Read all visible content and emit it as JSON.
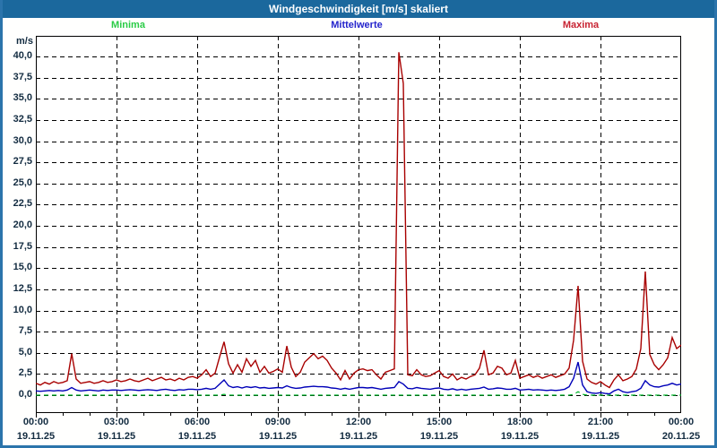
{
  "window": {
    "title": "Windgeschwindigkeit [m/s] skaliert"
  },
  "colors": {
    "titlebar_bg": "#1b689d",
    "titlebar_text": "#ffffff",
    "frame_border": "#2b74ab",
    "axis_text": "#122b40",
    "grid": "#000000",
    "minima_line": "#00b42a",
    "mittelwerte_line": "#0000b8",
    "maxima_line": "#a80000"
  },
  "legend": [
    {
      "label": "Minima",
      "color": "#2acc46"
    },
    {
      "label": "Mittelwerte",
      "color": "#2424cc"
    },
    {
      "label": "Maxima",
      "color": "#c82332"
    }
  ],
  "chart_data": {
    "type": "line",
    "title": "Windgeschwindigkeit [m/s] skaliert",
    "xlabel": "",
    "ylabel": "m/s",
    "ylim": [
      -2.1,
      42.4
    ],
    "yticks": [
      0,
      2.5,
      5,
      7.5,
      10,
      12.5,
      15,
      17.5,
      20,
      22.5,
      25,
      27.5,
      30,
      32.5,
      35,
      37.5,
      40
    ],
    "ytick_labels": [
      "0,0",
      "2,5",
      "5,0",
      "7,5",
      "10,0",
      "12,5",
      "15,0",
      "17,5",
      "20,0",
      "22,5",
      "25,0",
      "27,5",
      "30,0",
      "32,5",
      "35,0",
      "37,5",
      "40,0"
    ],
    "grid": "dashed",
    "legend_position": "top",
    "x_step_minutes": 10,
    "xlim_minutes": [
      0,
      1440
    ],
    "minor_tick_interval_minutes": 60,
    "xticks": [
      {
        "minute": 0,
        "time": "00:00",
        "date": "19.11.25"
      },
      {
        "minute": 180,
        "time": "03:00",
        "date": "19.11.25"
      },
      {
        "minute": 360,
        "time": "06:00",
        "date": "19.11.25"
      },
      {
        "minute": 540,
        "time": "09:00",
        "date": "19.11.25"
      },
      {
        "minute": 720,
        "time": "12:00",
        "date": "19.11.25"
      },
      {
        "minute": 900,
        "time": "15:00",
        "date": "19.11.25"
      },
      {
        "minute": 1080,
        "time": "18:00",
        "date": "19.11.25"
      },
      {
        "minute": 1260,
        "time": "21:00",
        "date": "19.11.25"
      },
      {
        "minute": 1440,
        "time": "00:00",
        "date": "20.11.25"
      }
    ],
    "series": [
      {
        "name": "Minima",
        "color": "#00b42a",
        "style": "dashed",
        "values": [
          0,
          0,
          0,
          0,
          0,
          0,
          0,
          0,
          0,
          0,
          0,
          0,
          0,
          0,
          0,
          0,
          0,
          0,
          0,
          0,
          0,
          0,
          0,
          0,
          0,
          0,
          0,
          0,
          0,
          0,
          0,
          0,
          0,
          0,
          0,
          0,
          0,
          0,
          0,
          0,
          0,
          0,
          0.1,
          0,
          0,
          0,
          0,
          0,
          0,
          0,
          0,
          0,
          0,
          0,
          0,
          0,
          0,
          0,
          0,
          0,
          0,
          0,
          0,
          0,
          0,
          0,
          0,
          0,
          0,
          0,
          0,
          0,
          0,
          0,
          0,
          0,
          0,
          0,
          0,
          0,
          0,
          0,
          0,
          0,
          0,
          0,
          0,
          0,
          0,
          0,
          0,
          0,
          0,
          0,
          0,
          0,
          0,
          0,
          0,
          0,
          0,
          0,
          0,
          0,
          0,
          0,
          0,
          0,
          0,
          0,
          0,
          0,
          0,
          0,
          0,
          0,
          0,
          0,
          0,
          0,
          0.1,
          0.4,
          0.1,
          0,
          0,
          0,
          0,
          0,
          0,
          0,
          0,
          0,
          0,
          0,
          0,
          0,
          0,
          0,
          0,
          0,
          0,
          0,
          0,
          0,
          0
        ]
      },
      {
        "name": "Mittelwerte",
        "color": "#0000b8",
        "style": "solid",
        "values": [
          0.5,
          0.45,
          0.5,
          0.55,
          0.5,
          0.55,
          0.5,
          0.6,
          0.9,
          0.6,
          0.5,
          0.55,
          0.6,
          0.55,
          0.5,
          0.6,
          0.55,
          0.6,
          0.6,
          0.55,
          0.6,
          0.65,
          0.6,
          0.55,
          0.6,
          0.65,
          0.6,
          0.55,
          0.65,
          0.7,
          0.6,
          0.55,
          0.65,
          0.6,
          0.7,
          0.7,
          0.65,
          0.7,
          0.8,
          0.7,
          0.8,
          1.3,
          1.8,
          1.1,
          0.9,
          1.0,
          0.85,
          1.0,
          0.9,
          1.0,
          0.85,
          0.9,
          0.8,
          0.85,
          0.9,
          0.85,
          1.1,
          0.9,
          0.8,
          0.85,
          0.95,
          1.0,
          1.05,
          1.0,
          1.0,
          0.95,
          0.85,
          0.8,
          0.7,
          0.8,
          0.7,
          0.8,
          0.9,
          0.9,
          0.85,
          0.9,
          0.8,
          0.7,
          0.8,
          0.85,
          0.9,
          1.6,
          1.3,
          0.8,
          0.75,
          0.9,
          0.8,
          0.75,
          0.7,
          0.8,
          0.85,
          0.7,
          0.65,
          0.75,
          0.6,
          0.7,
          0.6,
          0.7,
          0.75,
          0.8,
          0.95,
          0.7,
          0.75,
          0.85,
          0.8,
          0.7,
          0.7,
          0.8,
          0.6,
          0.65,
          0.7,
          0.6,
          0.65,
          0.6,
          0.55,
          0.6,
          0.55,
          0.6,
          0.7,
          1.0,
          2.0,
          3.9,
          1.2,
          0.4,
          0.25,
          0.2,
          0.3,
          0.2,
          0.15,
          0.5,
          0.7,
          0.4,
          0.3,
          0.4,
          0.5,
          0.8,
          1.7,
          1.2,
          1.0,
          0.95,
          1.1,
          1.2,
          1.4,
          1.2,
          1.3
        ]
      },
      {
        "name": "Maxima",
        "color": "#a80000",
        "style": "solid",
        "values": [
          1.4,
          1.2,
          1.5,
          1.3,
          1.6,
          1.4,
          1.5,
          1.7,
          4.9,
          1.9,
          1.4,
          1.5,
          1.6,
          1.4,
          1.5,
          1.7,
          1.5,
          1.6,
          1.8,
          1.6,
          1.7,
          1.9,
          1.7,
          1.6,
          1.8,
          2.0,
          1.7,
          1.9,
          2.1,
          1.8,
          1.9,
          1.7,
          2.0,
          1.8,
          2.1,
          2.2,
          2.0,
          2.4,
          3.0,
          2.2,
          2.6,
          4.5,
          6.3,
          3.7,
          2.6,
          3.6,
          2.7,
          4.3,
          3.4,
          4.1,
          2.7,
          3.4,
          2.6,
          2.8,
          3.1,
          2.7,
          5.8,
          3.3,
          2.2,
          2.7,
          3.9,
          4.4,
          4.9,
          4.3,
          4.6,
          4.1,
          3.2,
          2.6,
          1.8,
          2.9,
          1.9,
          2.6,
          3.0,
          3.1,
          2.9,
          3.0,
          2.4,
          1.9,
          2.7,
          2.9,
          3.1,
          40.5,
          36.8,
          2.4,
          2.3,
          3.0,
          2.4,
          2.2,
          2.3,
          2.6,
          2.9,
          2.2,
          2.0,
          2.5,
          1.8,
          2.1,
          1.9,
          2.2,
          2.4,
          3.2,
          5.3,
          2.4,
          2.6,
          3.4,
          3.2,
          2.4,
          2.6,
          4.1,
          2.0,
          2.2,
          2.4,
          2.1,
          2.3,
          2.0,
          2.2,
          2.4,
          2.1,
          2.3,
          2.5,
          3.2,
          6.5,
          12.9,
          4.0,
          1.9,
          1.5,
          1.3,
          1.6,
          1.2,
          0.9,
          1.8,
          2.4,
          1.7,
          1.9,
          2.2,
          3.1,
          5.5,
          14.6,
          4.8,
          3.6,
          3.0,
          3.6,
          4.4,
          6.8,
          5.5,
          5.9
        ]
      }
    ]
  }
}
